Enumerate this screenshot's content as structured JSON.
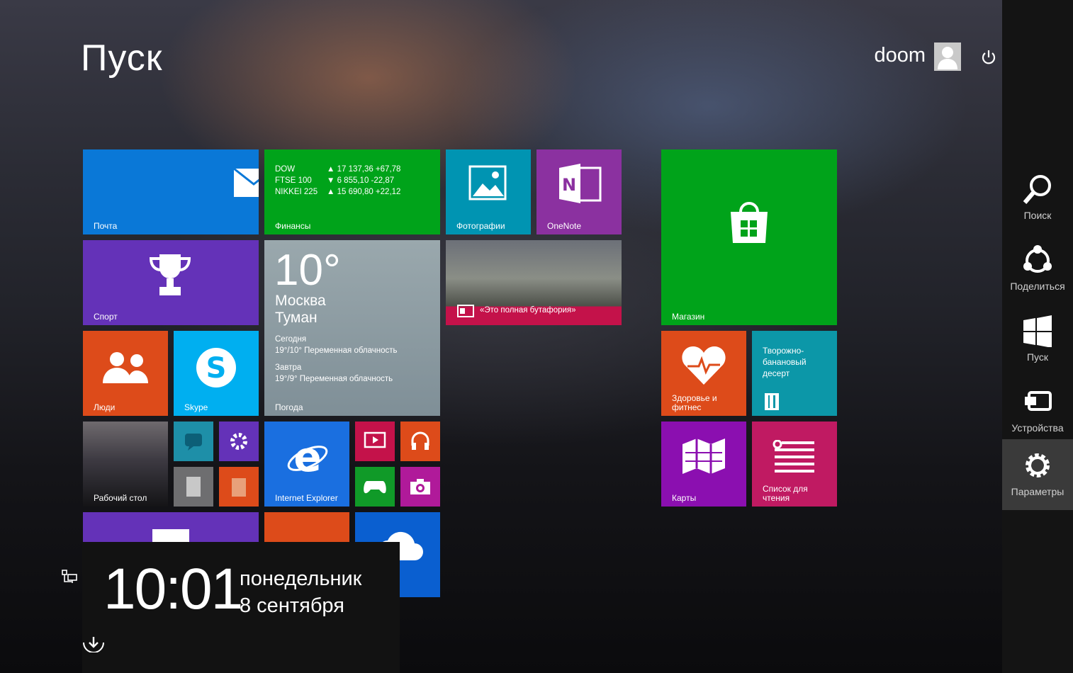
{
  "header": {
    "title": "Пуск",
    "user_name": "doom"
  },
  "tiles": {
    "mail": "Почта",
    "finance": {
      "label": "Финансы",
      "rows": [
        {
          "name": "DOW",
          "value": "▲ 17 137,36 +67,78"
        },
        {
          "name": "FTSE 100",
          "value": "▼ 6 855,10 -22,87"
        },
        {
          "name": "NIKKEI 225",
          "value": "▲ 15 690,80 +22,12"
        }
      ]
    },
    "photos": "Фотографии",
    "onenote": "OneNote",
    "store": "Магазин",
    "sport": "Спорт",
    "weather": {
      "temp": "10°",
      "city": "Москва",
      "condition": "Туман",
      "today_label": "Сегодня",
      "today_text": "19°/10° Переменная облачность",
      "tomorrow_label": "Завтра",
      "tomorrow_text": "19°/9° Переменная облачность",
      "label": "Погода"
    },
    "news": "«Это полная бутафория»",
    "people": "Люди",
    "skype": "Skype",
    "health": "Здоровье и фитнес",
    "recipe": "Творожно-банановый десерт",
    "desktop": "Рабочий стол",
    "ie": "Internet Explorer",
    "maps": "Карты",
    "reading": "Список для чтения"
  },
  "charms": [
    {
      "label": "Поиск",
      "icon": "search-icon"
    },
    {
      "label": "Поделиться",
      "icon": "share-icon"
    },
    {
      "label": "Пуск",
      "icon": "windows-icon"
    },
    {
      "label": "Устройства",
      "icon": "devices-icon"
    },
    {
      "label": "Параметры",
      "icon": "gear-icon"
    }
  ],
  "clock": {
    "time": "10:01",
    "weekday": "понедельник",
    "date": "8 сентября"
  },
  "colors": {
    "mail": "#0a78d7",
    "finance": "#00a31a",
    "photos": "#0094b2",
    "onenote": "#8b31a0",
    "store": "#00a31a",
    "sport": "#6432b8",
    "weather": "#8a9aa2",
    "news": "#c4124a",
    "people": "#dd4b1a",
    "skype": "#00aff0",
    "health": "#dd4b1a",
    "recipe": "#0c97a8",
    "maps": "#8b0fb0",
    "reading": "#c01a62",
    "ie": "#1a6fe0",
    "charm_active": "#3a3a3a"
  }
}
